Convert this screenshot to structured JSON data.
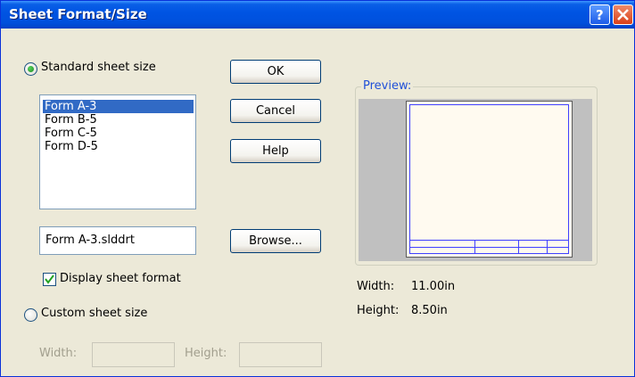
{
  "window": {
    "title": "Sheet Format/Size"
  },
  "standard": {
    "radio_label": "Standard sheet size",
    "items": [
      "Form A-3",
      "Form B-5",
      "Form C-5",
      "Form D-5"
    ],
    "selected_index": 0,
    "file_value": "Form A-3.slddrt",
    "display_format_label": "Display sheet format",
    "display_format_checked": true
  },
  "custom": {
    "radio_label": "Custom sheet size",
    "width_label": "Width:",
    "height_label": "Height:",
    "width_value": "",
    "height_value": ""
  },
  "buttons": {
    "ok": "OK",
    "cancel": "Cancel",
    "help": "Help",
    "browse": "Browse..."
  },
  "preview": {
    "title": "Preview:",
    "width_label": "Width:",
    "width_value": "11.00in",
    "height_label": "Height:",
    "height_value": "8.50in"
  },
  "icons": {
    "help": "help-icon",
    "close": "close-icon"
  },
  "colors": {
    "titlebar": "#0054e3",
    "selection": "#316ac5",
    "preview_bg": "#c0c0c0",
    "border_lines": "#4040ff"
  }
}
